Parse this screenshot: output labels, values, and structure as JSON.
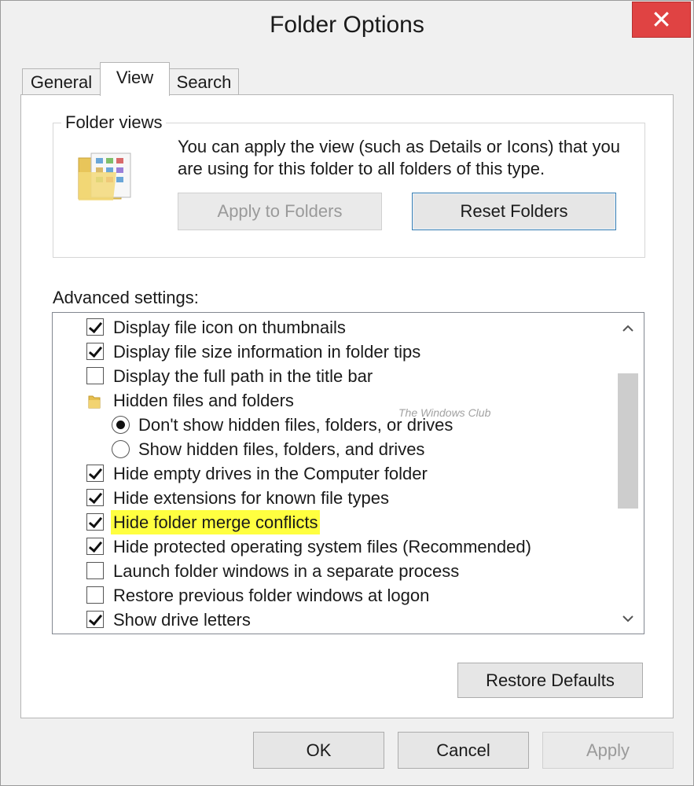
{
  "window": {
    "title": "Folder Options",
    "close_glyph": "✕"
  },
  "tabs": [
    {
      "label": "General",
      "active": false
    },
    {
      "label": "View",
      "active": true
    },
    {
      "label": "Search",
      "active": false
    }
  ],
  "folder_views": {
    "legend": "Folder views",
    "description": "You can apply the view (such as Details or Icons) that you are using for this folder to all folders of this type.",
    "apply_button": "Apply to Folders",
    "reset_button": "Reset Folders"
  },
  "advanced": {
    "label": "Advanced settings:",
    "items": [
      {
        "type": "checkbox",
        "label": "Display file icon on thumbnails",
        "checked": true
      },
      {
        "type": "checkbox",
        "label": "Display file size information in folder tips",
        "checked": true
      },
      {
        "type": "checkbox",
        "label": "Display the full path in the title bar",
        "checked": false
      },
      {
        "type": "folder",
        "label": "Hidden files and folders",
        "icon": "folder-icon"
      },
      {
        "type": "radio",
        "label": "Don't show hidden files, folders, or drives",
        "checked": true
      },
      {
        "type": "radio",
        "label": "Show hidden files, folders, and drives",
        "checked": false
      },
      {
        "type": "checkbox",
        "label": "Hide empty drives in the Computer folder",
        "checked": true
      },
      {
        "type": "checkbox",
        "label": "Hide extensions for known file types",
        "checked": true
      },
      {
        "type": "checkbox",
        "label": "Hide folder merge conflicts",
        "checked": true,
        "highlighted": true
      },
      {
        "type": "checkbox",
        "label": "Hide protected operating system files (Recommended)",
        "checked": true
      },
      {
        "type": "checkbox",
        "label": "Launch folder windows in a separate process",
        "checked": false
      },
      {
        "type": "checkbox",
        "label": "Restore previous folder windows at logon",
        "checked": false
      },
      {
        "type": "checkbox",
        "label": "Show drive letters",
        "checked": true
      }
    ],
    "watermark": "The Windows Club",
    "highlight_color": "#ffff40"
  },
  "buttons": {
    "restore_defaults": "Restore Defaults",
    "ok": "OK",
    "cancel": "Cancel",
    "apply": "Apply"
  },
  "colors": {
    "close_button": "#e04343",
    "focus_border": "#3c7fb1"
  }
}
